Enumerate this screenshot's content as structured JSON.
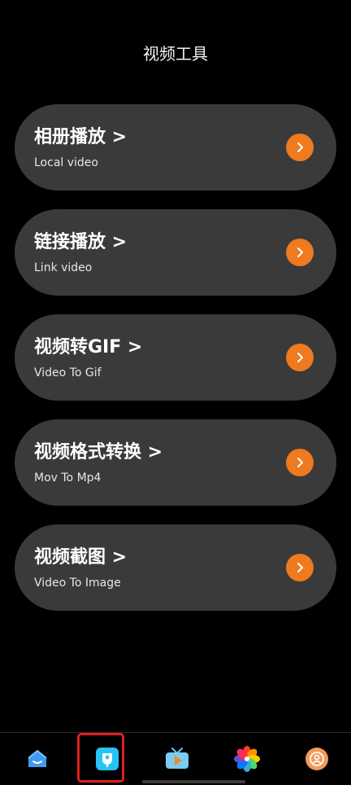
{
  "header": {
    "title": "视频工具"
  },
  "cards": [
    {
      "title": "相册播放 >",
      "subtitle": "Local video"
    },
    {
      "title": "链接播放 >",
      "subtitle": "Link video"
    },
    {
      "title": "视频转GIF >",
      "subtitle": "Video To Gif"
    },
    {
      "title": "视频格式转换 >",
      "subtitle": "Mov To Mp4"
    },
    {
      "title": "视频截图 >",
      "subtitle": "Video To Image"
    }
  ],
  "tabbar": {
    "tabs": [
      {
        "icon": "home-icon"
      },
      {
        "icon": "video-tools-icon",
        "selected": true
      },
      {
        "icon": "tv-play-icon"
      },
      {
        "icon": "photos-flower-icon"
      },
      {
        "icon": "profile-icon"
      }
    ]
  },
  "colors": {
    "background": "#000000",
    "card": "#3a3a3a",
    "accent": "#ef7a20",
    "highlight": "#e01e1e"
  }
}
